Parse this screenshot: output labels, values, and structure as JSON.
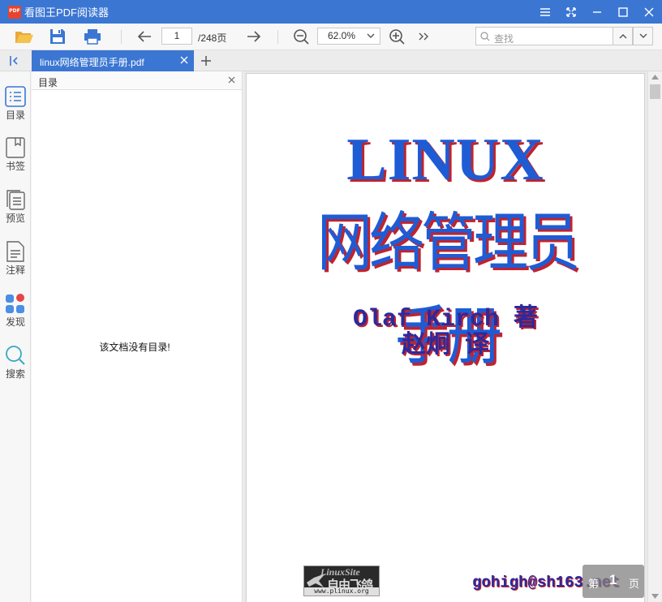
{
  "window": {
    "title": "看图王PDF阅读器",
    "accent_color": "#3b76d3"
  },
  "toolbar": {
    "icons": [
      "open-folder-icon",
      "save-icon",
      "print-icon",
      "arrow-left-icon",
      "arrow-right-icon",
      "zoom-out-icon",
      "zoom-in-icon",
      "more-icon"
    ],
    "current_page": "1",
    "total_pages": "/248页",
    "zoom_value": "62.0%",
    "search_placeholder": "查找"
  },
  "tabs": [
    {
      "label": "linux网络管理员手册.pdf",
      "active": true
    }
  ],
  "rail": {
    "items": [
      {
        "label": "目录",
        "icon": "toc-list-icon"
      },
      {
        "label": "书签",
        "icon": "bookmark-icon"
      },
      {
        "label": "预览",
        "icon": "thumbnails-icon"
      },
      {
        "label": "注释",
        "icon": "annotation-icon"
      },
      {
        "label": "发现",
        "icon": "apps-icon"
      },
      {
        "label": "搜索",
        "icon": "search-icon"
      }
    ]
  },
  "toc_panel": {
    "title": "目录",
    "empty_message": "该文档没有目录!"
  },
  "document": {
    "title_en": "LINUX",
    "title_cn": "网络管理员手册",
    "author": "Olaf Kirch 著",
    "translator": "赵炯 译",
    "site_logo": {
      "top_text": "LinuxSite",
      "mid_text": "自由飞鸽",
      "url_text": "www.plinux.org"
    },
    "email": "gohigh@sh163.net"
  },
  "page_badge": {
    "prefix": "第",
    "number": "1",
    "suffix": "页"
  }
}
